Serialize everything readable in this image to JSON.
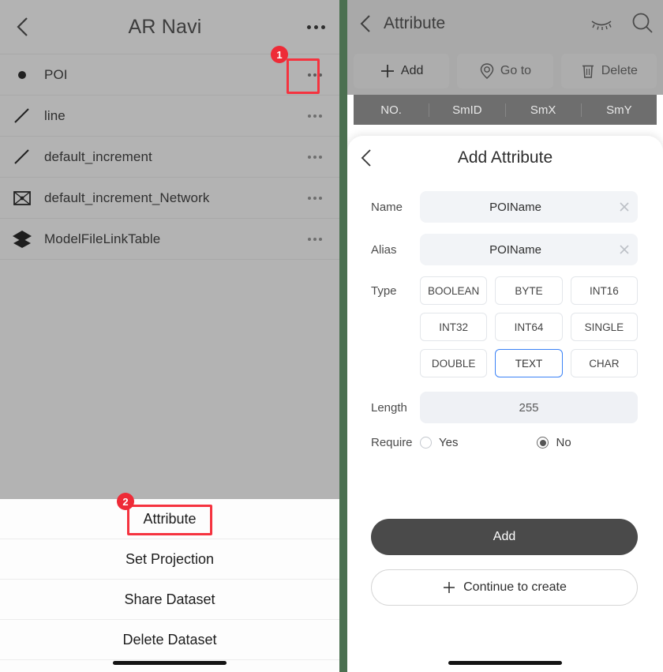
{
  "left": {
    "header": {
      "title": "AR Navi",
      "back_icon": "chevron-left-icon",
      "more_icon": "ellipsis-icon"
    },
    "datasets": [
      {
        "name": "POI",
        "icon": "point-icon",
        "more_icon": "ellipsis-icon",
        "highlighted": true
      },
      {
        "name": "line",
        "icon": "line-icon",
        "more_icon": "ellipsis-icon",
        "highlighted": false
      },
      {
        "name": "default_increment",
        "icon": "line-icon",
        "more_icon": "ellipsis-icon",
        "highlighted": false
      },
      {
        "name": "default_increment_Network",
        "icon": "network-icon",
        "more_icon": "ellipsis-icon",
        "highlighted": false
      },
      {
        "name": "ModelFileLinkTable",
        "icon": "layers-icon",
        "more_icon": "ellipsis-icon",
        "highlighted": false
      }
    ],
    "sheet": {
      "items": [
        {
          "label": "Attribute",
          "highlighted": true
        },
        {
          "label": "Set Projection",
          "highlighted": false
        },
        {
          "label": "Share Dataset",
          "highlighted": false
        },
        {
          "label": "Delete Dataset",
          "highlighted": false
        }
      ]
    },
    "badges": [
      {
        "number": "1"
      },
      {
        "number": "2"
      }
    ]
  },
  "right": {
    "header": {
      "title": "Attribute",
      "back_icon": "chevron-left-icon",
      "hide_icon": "eye-closed-icon",
      "search_icon": "search-icon"
    },
    "toolbar": [
      {
        "label": "Add",
        "icon": "plus-icon"
      },
      {
        "label": "Go to",
        "icon": "location-pin-icon"
      },
      {
        "label": "Delete",
        "icon": "trash-icon"
      }
    ],
    "table_headers": [
      "NO.",
      "SmID",
      "SmX",
      "SmY"
    ],
    "modal": {
      "title": "Add Attribute",
      "back_icon": "chevron-left-icon",
      "fields": [
        {
          "label": "Name",
          "value": "POIName",
          "clear_icon": "close-icon"
        },
        {
          "label": "Alias",
          "value": "POIName",
          "clear_icon": "close-icon"
        }
      ],
      "type_label": "Type",
      "types": [
        {
          "label": "BOOLEAN",
          "selected": false
        },
        {
          "label": "BYTE",
          "selected": false
        },
        {
          "label": "INT16",
          "selected": false
        },
        {
          "label": "INT32",
          "selected": false
        },
        {
          "label": "INT64",
          "selected": false
        },
        {
          "label": "SINGLE",
          "selected": false
        },
        {
          "label": "DOUBLE",
          "selected": false
        },
        {
          "label": "TEXT",
          "selected": true
        },
        {
          "label": "CHAR",
          "selected": false
        }
      ],
      "length_label": "Length",
      "length_value": "255",
      "require_label": "Require",
      "require_options": [
        {
          "label": "Yes",
          "checked": false
        },
        {
          "label": "No",
          "checked": true
        }
      ],
      "add_button": "Add",
      "continue_button": "Continue to create",
      "continue_icon": "plus-icon"
    }
  },
  "colors": {
    "accent_blue": "#3b82f6",
    "badge_red": "#ee2b37",
    "highlight_red": "#f5333f",
    "divider_green": "#4b7050",
    "panel_gray": "#b3b3b3"
  }
}
